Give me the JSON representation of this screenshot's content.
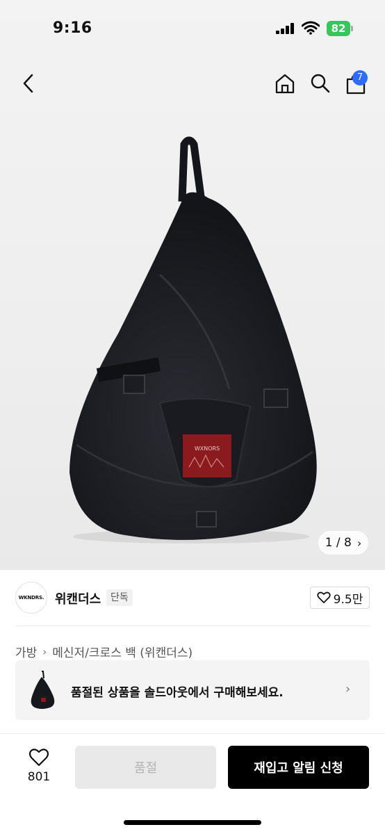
{
  "status_bar": {
    "time": "9:16",
    "battery": "82"
  },
  "header": {
    "cart_badge": "7"
  },
  "gallery": {
    "current": "1",
    "total": "8",
    "counter_text": "1 / 8",
    "print_text": "WXNORS"
  },
  "brand": {
    "logo_text": "WKNDRS.",
    "name": "위캔더스",
    "tag": "단독",
    "likes": "9.5만"
  },
  "breadcrumb": {
    "category": "가방",
    "subcategory": "메신저/크로스 백 (위캔더스)"
  },
  "soldout_banner": {
    "text": "품절된 상품을 솔드아웃에서 구매해보세요."
  },
  "bottom": {
    "wish_count": "801",
    "soldout_label": "품절",
    "restock_label": "재입고 알림 신청"
  },
  "colors": {
    "accent_blue": "#2f6bff",
    "battery_green": "#34c759",
    "primary_button": "#000000",
    "bag_red_patch": "#8b1a1f"
  },
  "icons": [
    "chevron-left-icon",
    "home-icon",
    "search-icon",
    "cart-icon",
    "heart-icon",
    "chevron-right-icon"
  ]
}
